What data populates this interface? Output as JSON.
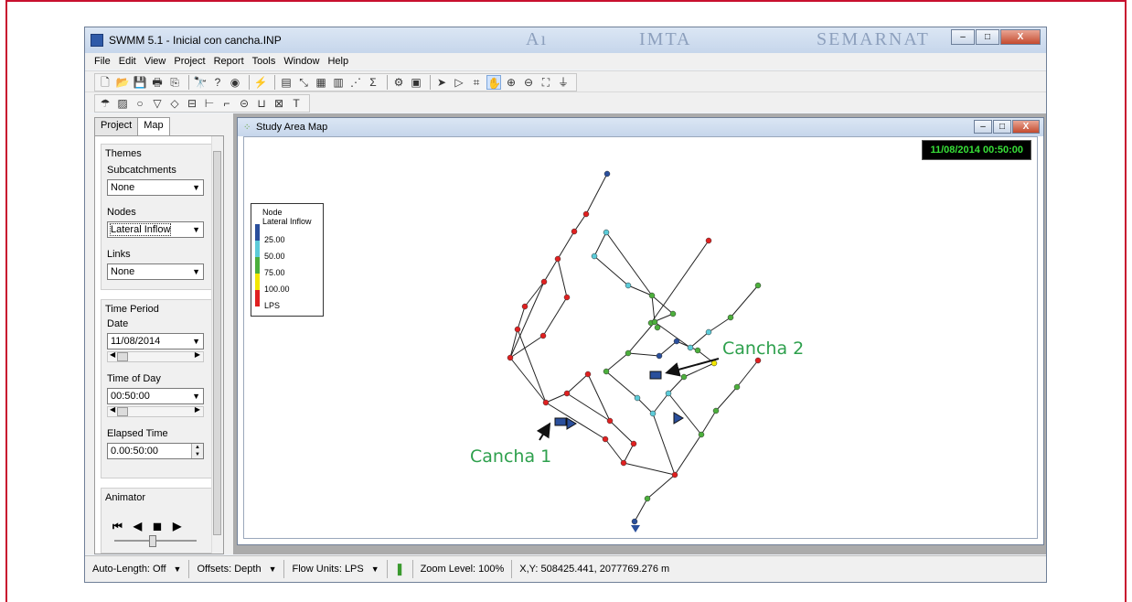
{
  "app": {
    "title": "SWMM 5.1 - Inicial con cancha.INP",
    "brand_left": "Aı",
    "brand_center": "IMTA",
    "brand_right": "SEMARNAT",
    "window_buttons": {
      "minimize": "–",
      "maximize": "□",
      "close": "X"
    }
  },
  "menu": [
    "File",
    "Edit",
    "View",
    "Project",
    "Report",
    "Tools",
    "Window",
    "Help"
  ],
  "toolbar1_icons": [
    "new-file-icon",
    "open-folder-icon",
    "save-icon",
    "print-icon",
    "copy-icon",
    "find-icon",
    "query-icon",
    "overview-map-icon",
    "run-icon",
    "report-icon",
    "profile-plot-icon",
    "time-series-plot-icon",
    "table-icon",
    "scatter-plot-icon",
    "statistics-icon",
    "options-icon",
    "arrange-windows-icon",
    "select-object-icon",
    "select-vertex-icon",
    "select-region-icon",
    "pan-icon",
    "zoom-in-icon",
    "zoom-out-icon",
    "full-extent-icon",
    "measure-icon"
  ],
  "toolbar1_glyphs": [
    "🗋",
    "📂",
    "💾",
    "🖶",
    "⎘",
    "🔭",
    "?",
    "◉",
    "⚡",
    "▤",
    "⤡",
    "▦",
    "▥",
    "⋰",
    "Σ",
    "⚙",
    "▣",
    "➤",
    "▷",
    "⌗",
    "✋",
    "⊕",
    "⊖",
    "⛶",
    "⏚"
  ],
  "toolbar2_icons": [
    "rain-gage-icon",
    "subcatchment-icon",
    "junction-icon",
    "outfall-icon",
    "divider-icon",
    "storage-icon",
    "conduit-icon",
    "pump-icon",
    "orifice-icon",
    "weir-icon",
    "outlet-icon",
    "label-icon"
  ],
  "toolbar2_glyphs": [
    "☂",
    "▨",
    "○",
    "▽",
    "◇",
    "⊟",
    "⊢",
    "⌐",
    "⊝",
    "⊔",
    "⊠",
    "T"
  ],
  "panel": {
    "tabs": [
      "Project",
      "Map"
    ],
    "active_tab": "Map",
    "themes_title": "Themes",
    "subcatchments_label": "Subcatchments",
    "subcatchments_value": "None",
    "nodes_label": "Nodes",
    "nodes_value": "Lateral Inflow",
    "links_label": "Links",
    "links_value": "None",
    "time_period_title": "Time Period",
    "date_label": "Date",
    "date_value": "11/08/2014",
    "time_of_day_label": "Time of Day",
    "time_of_day_value": "00:50:00",
    "elapsed_label": "Elapsed Time",
    "elapsed_value": "0.00:50:00",
    "animator_title": "Animator",
    "animator_buttons": [
      "⏮",
      "◀",
      "◼",
      "▶"
    ]
  },
  "map": {
    "title": "Study Area Map",
    "clock": "11/08/2014 00:50:00",
    "legend": {
      "title_line1": "Node",
      "title_line2": "Lateral Inflow",
      "values": [
        "25.00",
        "50.00",
        "75.00",
        "100.00",
        "LPS"
      ],
      "colors": [
        "#2a4f9c",
        "#5ccbd8",
        "#4caf3c",
        "#f2e600",
        "#e02020"
      ]
    }
  },
  "annotations": {
    "cancha1": "Cancha 1",
    "cancha2": "Cancha 2"
  },
  "statusbar": {
    "auto_length": "Auto-Length: Off",
    "offsets": "Offsets: Depth",
    "flow_units": "Flow Units: LPS",
    "zoom": "Zoom Level: 100%",
    "xy": "X,Y: 508425.441, 2077769.276 m"
  }
}
